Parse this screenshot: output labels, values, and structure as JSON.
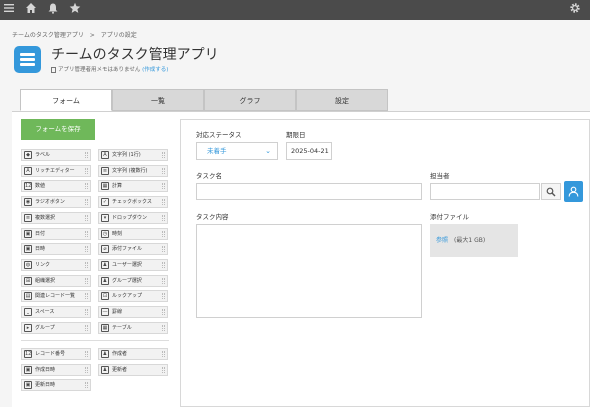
{
  "topbar": {
    "icons": [
      "menu-icon",
      "home-icon",
      "bell-icon",
      "star-icon",
      "gear-icon"
    ],
    "background": "#4b4b4b"
  },
  "breadcrumb": {
    "items": [
      "チームのタスク管理アプリ",
      ">",
      "アプリの設定"
    ]
  },
  "app": {
    "title": "チームのタスク管理アプリ",
    "desc": "アプリ管理者用メモはありません",
    "create_link": "(作成する)",
    "icon_color": "#3498db"
  },
  "tabs": [
    {
      "label": "フォーム",
      "active": true
    },
    {
      "label": "一覧",
      "active": false
    },
    {
      "label": "グラフ",
      "active": false
    },
    {
      "label": "設定",
      "active": false
    }
  ],
  "save_button": "フォームを保存",
  "palette": [
    {
      "label": "ラベル",
      "icon": "label-icon",
      "glyph": "◆"
    },
    {
      "label": "文字列 (1行)",
      "icon": "text-line-icon",
      "glyph": "A"
    },
    {
      "label": "リッチエディター",
      "icon": "rich-editor-icon",
      "glyph": "A"
    },
    {
      "label": "文字列 (複数行)",
      "icon": "text-multiline-icon",
      "glyph": "≡"
    },
    {
      "label": "数値",
      "icon": "number-icon",
      "glyph": "12"
    },
    {
      "label": "計算",
      "icon": "calc-icon",
      "glyph": "▦"
    },
    {
      "label": "ラジオボタン",
      "icon": "radio-icon",
      "glyph": "◉"
    },
    {
      "label": "チェックボックス",
      "icon": "checkbox-icon",
      "glyph": "✓"
    },
    {
      "label": "複数選択",
      "icon": "multi-select-icon",
      "glyph": "≡"
    },
    {
      "label": "ドロップダウン",
      "icon": "dropdown-icon",
      "glyph": "▾"
    },
    {
      "label": "日付",
      "icon": "date-icon",
      "glyph": "▣"
    },
    {
      "label": "時刻",
      "icon": "time-icon",
      "glyph": "◷"
    },
    {
      "label": "日時",
      "icon": "datetime-icon",
      "glyph": "▣"
    },
    {
      "label": "添付ファイル",
      "icon": "attachment-icon",
      "glyph": "⌀"
    },
    {
      "label": "リンク",
      "icon": "link-icon",
      "glyph": "◍"
    },
    {
      "label": "ユーザー選択",
      "icon": "user-select-icon",
      "glyph": "♟"
    },
    {
      "label": "組織選択",
      "icon": "org-select-icon",
      "glyph": "⊞"
    },
    {
      "label": "グループ選択",
      "icon": "group-select-icon",
      "glyph": "♟"
    },
    {
      "label": "関連レコード一覧",
      "icon": "related-records-icon",
      "glyph": "▤"
    },
    {
      "label": "ルックアップ",
      "icon": "lookup-icon",
      "glyph": "⊡"
    },
    {
      "label": "スペース",
      "icon": "space-icon",
      "glyph": "⎵"
    },
    {
      "label": "罫線",
      "icon": "rule-line-icon",
      "glyph": "—"
    },
    {
      "label": "グループ",
      "icon": "group-icon",
      "glyph": "▸"
    },
    {
      "label": "テーブル",
      "icon": "table-icon",
      "glyph": "▦"
    }
  ],
  "system_fields": [
    {
      "label": "レコード番号",
      "icon": "record-number-icon",
      "glyph": "12"
    },
    {
      "label": "作成者",
      "icon": "creator-icon",
      "glyph": "♟"
    },
    {
      "label": "作成日時",
      "icon": "created-at-icon",
      "glyph": "▣"
    },
    {
      "label": "更新者",
      "icon": "updater-icon",
      "glyph": "♟"
    },
    {
      "label": "更新日時",
      "icon": "updated-at-icon",
      "glyph": "▣"
    }
  ],
  "form": {
    "status_label": "対応ステータス",
    "status_value": "未着手",
    "due_label": "期限日",
    "due_value": "2025-04-21",
    "task_name_label": "タスク名",
    "assignee_label": "担当者",
    "task_content_label": "タスク内容",
    "attachment_label": "添付ファイル",
    "browse": "参照",
    "max_size": "(最大1 GB)"
  }
}
